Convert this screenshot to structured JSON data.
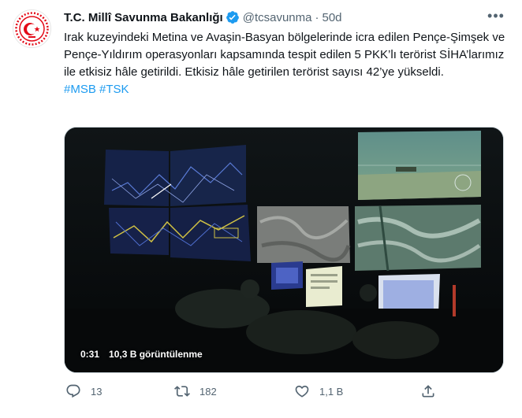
{
  "account": {
    "name": "T.C. Millî Savunma Bakanlığı",
    "handle": "@tcsavunma",
    "separator": "·",
    "time": "50d",
    "verified_color": "#1d9bf0",
    "avatar_icon": "ministry-emblem-icon",
    "avatar_color": "#e30a17"
  },
  "tweet": {
    "text": "Irak kuzeyindeki Metina ve Avaşin-Basyan bölgelerinde icra edilen Pençe-Şimşek ve Pençe-Yıldırım operasyonları kapsamında tespit edilen 5 PKK’lı terörist SİHA’larımız ile etkisiz hâle getirildi. Etkisiz hâle getirilen terörist sayısı 42’ye yükseldi.",
    "hashtags": [
      "#MSB",
      "#TSK"
    ]
  },
  "media": {
    "duration": "0:31",
    "views": "10,3 B görüntülenme"
  },
  "actions": {
    "reply_count": "13",
    "retweet_count": "182",
    "like_count": "1,1 B",
    "reply_icon": "reply-icon",
    "retweet_icon": "retweet-icon",
    "like_icon": "heart-icon",
    "share_icon": "share-icon"
  },
  "colors": {
    "link": "#1d9bf0",
    "secondary_text": "#536471",
    "primary_text": "#0f1419"
  }
}
